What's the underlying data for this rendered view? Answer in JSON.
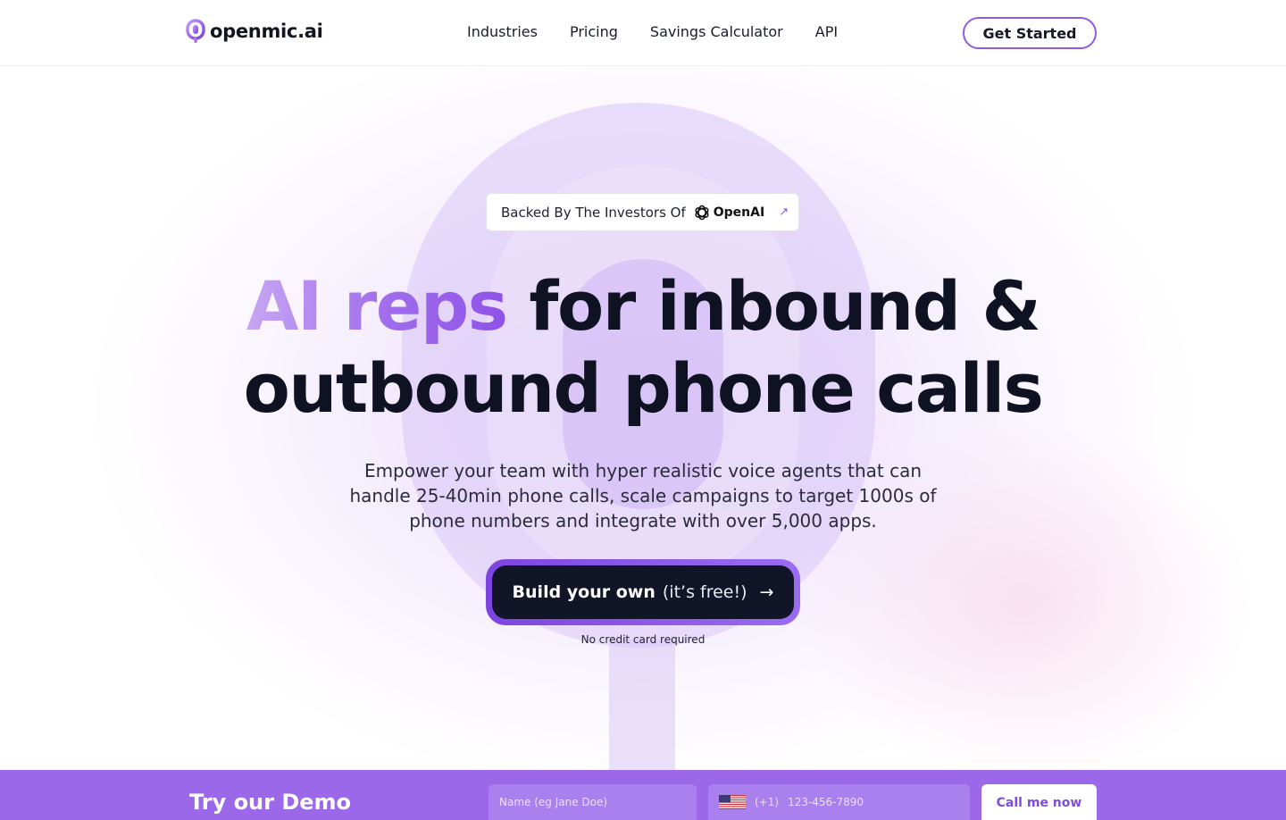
{
  "nav": {
    "logo_text": "openmic.ai",
    "links": [
      {
        "label": "Industries"
      },
      {
        "label": "Pricing"
      },
      {
        "label": "Savings Calculator"
      },
      {
        "label": "API"
      }
    ],
    "cta_label": "Get Started"
  },
  "hero": {
    "badge": {
      "text": "Backed By The Investors Of",
      "brand": "OpenAI",
      "brand_icon": "openai-logo-icon",
      "arrow_icon": "arrow-up-right-icon"
    },
    "headline": {
      "accent": "AI reps",
      "line1_rest": "for inbound &",
      "line2": "outbound phone calls"
    },
    "subtext": "Empower your team with hyper realistic voice agents that can handle 25-40min phone calls, scale campaigns to target 1000s of phone numbers and integrate with over 5,000 apps.",
    "cta": {
      "strong": "Build your own",
      "light": "(it’s free!)",
      "arrow": "→"
    },
    "cta_note": "No credit card required"
  },
  "demo": {
    "title": "Try our Demo",
    "name_placeholder": "Name (eg Jane Doe)",
    "country_code": "(+1)",
    "phone_placeholder": "123-456-7890",
    "call_label": "Call me now",
    "flag_icon": "us-flag-icon"
  },
  "colors": {
    "accent": "#9b68ea",
    "dark": "#121528",
    "accent_text": "#7f4ce0"
  }
}
